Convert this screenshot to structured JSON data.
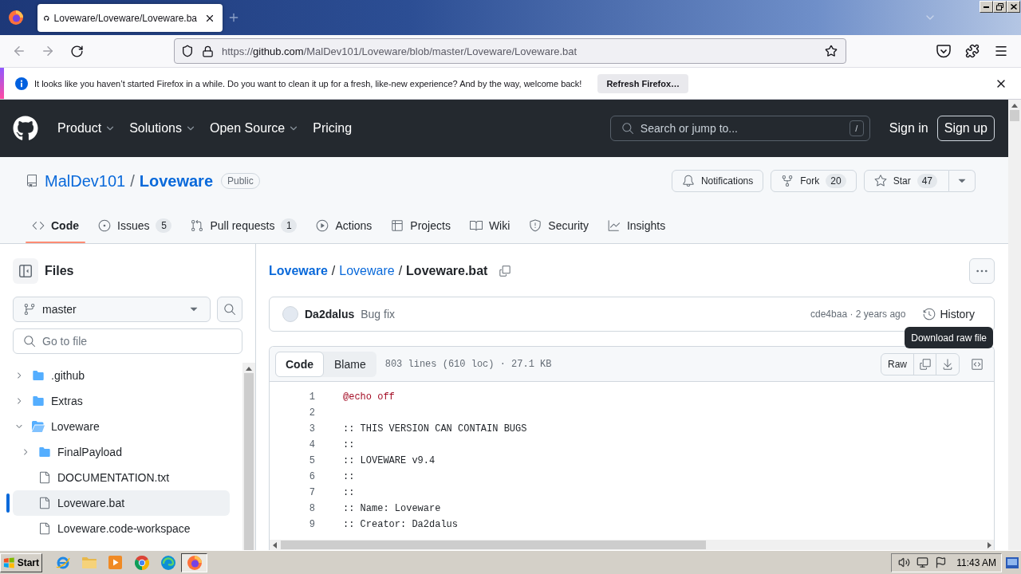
{
  "browser": {
    "tabs": [
      {
        "title": "Loveware/Loveware/Loveware.ba",
        "selected": true
      }
    ],
    "url": {
      "scheme": "https://",
      "host": "github.com",
      "path": "/MalDev101/Loveware/blob/master/Loveware/Loveware.bat"
    }
  },
  "notification": {
    "message": "It looks like you haven’t started Firefox in a while. Do you want to clean it up for a fresh, like-new experience? And by the way, welcome back!",
    "button": "Refresh Firefox…"
  },
  "site_header": {
    "nav": [
      {
        "label": "Product",
        "dropdown": true
      },
      {
        "label": "Solutions",
        "dropdown": true
      },
      {
        "label": "Open Source",
        "dropdown": true
      },
      {
        "label": "Pricing",
        "dropdown": false
      }
    ],
    "search": {
      "placeholder": "Search or jump to...",
      "shortcut": "/"
    },
    "sign_in": "Sign in",
    "sign_up": "Sign up"
  },
  "repo": {
    "owner": "MalDev101",
    "separator": "/",
    "name": "Loveware",
    "visibility": "Public",
    "notifications": "Notifications",
    "fork": {
      "label": "Fork",
      "count": "20"
    },
    "star": {
      "label": "Star",
      "count": "47"
    },
    "tabs": [
      {
        "label": "Code",
        "selected": true
      },
      {
        "label": "Issues",
        "count": "5",
        "selected": false
      },
      {
        "label": "Pull requests",
        "count": "1",
        "selected": false
      },
      {
        "label": "Actions",
        "selected": false
      },
      {
        "label": "Projects",
        "selected": false
      },
      {
        "label": "Wiki",
        "selected": false
      },
      {
        "label": "Security",
        "selected": false
      },
      {
        "label": "Insights",
        "selected": false
      }
    ]
  },
  "sidebar": {
    "title": "Files",
    "branch": "master",
    "filter": {
      "placeholder": "Go to file"
    },
    "tree": [
      {
        "name": ".github",
        "kind": "folder",
        "expanded": false,
        "selected": false
      },
      {
        "name": "Extras",
        "kind": "folder",
        "expanded": false,
        "selected": false
      },
      {
        "name": "Loveware",
        "kind": "folder",
        "expanded": true,
        "selected": false,
        "children": [
          {
            "name": "FinalPayload",
            "kind": "folder",
            "expanded": false,
            "selected": false
          },
          {
            "name": "DOCUMENTATION.txt",
            "kind": "file",
            "selected": false
          },
          {
            "name": "Loveware.bat",
            "kind": "file",
            "selected": true
          },
          {
            "name": "Loveware.code-workspace",
            "kind": "file",
            "selected": false
          }
        ]
      }
    ]
  },
  "file": {
    "breadcrumb": [
      {
        "label": "Loveware",
        "kind": "repo"
      },
      {
        "label": "/",
        "kind": "separator"
      },
      {
        "label": "Loveware",
        "kind": "folder"
      },
      {
        "label": "/",
        "kind": "separator"
      },
      {
        "label": "Loveware.bat",
        "kind": "current"
      }
    ],
    "commit": {
      "author": "Da2dalus",
      "message": "Bug fix",
      "meta": "cde4baa · 2 years ago",
      "history": "History"
    },
    "tooltip": "Download raw file",
    "views": [
      {
        "label": "Code",
        "selected": true
      },
      {
        "label": "Blame",
        "selected": false
      }
    ],
    "stats": "803 lines (610 loc) · 27.1 KB",
    "raw": "Raw",
    "lines": [
      {
        "number": "1",
        "kind": "command",
        "text": "@echo off"
      },
      {
        "number": "2",
        "kind": "blank"
      },
      {
        "number": "3",
        "kind": "comment",
        "text": ":: THIS VERSION CAN CONTAIN BUGS"
      },
      {
        "number": "4",
        "kind": "comment",
        "text": "::"
      },
      {
        "number": "5",
        "kind": "comment",
        "text": ":: LOVEWARE v9.4"
      },
      {
        "number": "6",
        "kind": "comment",
        "text": "::"
      },
      {
        "number": "7",
        "kind": "comment",
        "text": "::"
      },
      {
        "number": "8",
        "kind": "comment",
        "text": ":: Name: Loveware"
      },
      {
        "number": "9",
        "kind": "comment",
        "text": ":: Creator: Da2dalus"
      }
    ]
  },
  "taskbar": {
    "start": "Start",
    "apps": [
      {
        "selected": false
      },
      {
        "selected": false
      },
      {
        "selected": false
      },
      {
        "selected": false
      },
      {
        "selected": false
      },
      {
        "selected": true
      }
    ],
    "clock": "11:43 AM"
  }
}
